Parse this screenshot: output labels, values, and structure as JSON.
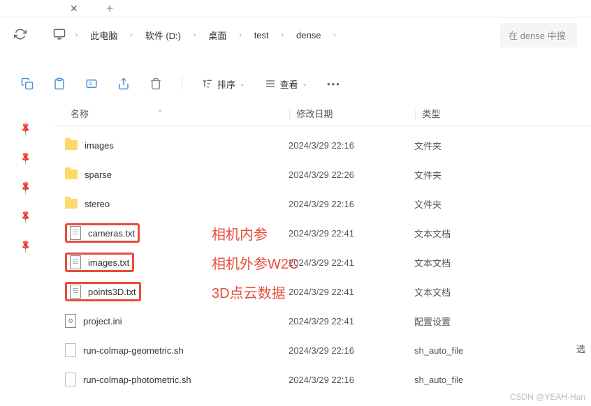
{
  "breadcrumb": [
    {
      "label": "此电脑"
    },
    {
      "label": "软件 (D:)"
    },
    {
      "label": "桌面"
    },
    {
      "label": "test"
    },
    {
      "label": "dense"
    }
  ],
  "search": {
    "placeholder": "在 dense 中搜"
  },
  "toolbar": {
    "sort_label": "排序",
    "view_label": "查看"
  },
  "columns": {
    "name": "名称",
    "date": "修改日期",
    "type": "类型"
  },
  "files": [
    {
      "name": "images",
      "date": "2024/3/29 22:16",
      "type": "文件夹",
      "icon": "folder",
      "boxed": false,
      "annotation": ""
    },
    {
      "name": "sparse",
      "date": "2024/3/29 22:26",
      "type": "文件夹",
      "icon": "folder",
      "boxed": false,
      "annotation": ""
    },
    {
      "name": "stereo",
      "date": "2024/3/29 22:16",
      "type": "文件夹",
      "icon": "folder",
      "boxed": false,
      "annotation": ""
    },
    {
      "name": "cameras.txt",
      "date": "2024/3/29 22:41",
      "type": "文本文档",
      "icon": "txt",
      "boxed": true,
      "annotation": "相机内参"
    },
    {
      "name": "images.txt",
      "date": "2024/3/29 22:41",
      "type": "文本文档",
      "icon": "txt",
      "boxed": true,
      "annotation": "相机外参W2C"
    },
    {
      "name": "points3D.txt",
      "date": "2024/3/29 22:41",
      "type": "文本文档",
      "icon": "txt",
      "boxed": true,
      "annotation": "3D点云数据"
    },
    {
      "name": "project.ini",
      "date": "2024/3/29 22:41",
      "type": "配置设置",
      "icon": "ini",
      "boxed": false,
      "annotation": ""
    },
    {
      "name": "run-colmap-geometric.sh",
      "date": "2024/3/29 22:16",
      "type": "sh_auto_file",
      "icon": "sh",
      "boxed": false,
      "annotation": ""
    },
    {
      "name": "run-colmap-photometric.sh",
      "date": "2024/3/29 22:16",
      "type": "sh_auto_file",
      "icon": "sh",
      "boxed": false,
      "annotation": ""
    }
  ],
  "select_label": "选",
  "watermark": "CSDN @YEAH-Han"
}
